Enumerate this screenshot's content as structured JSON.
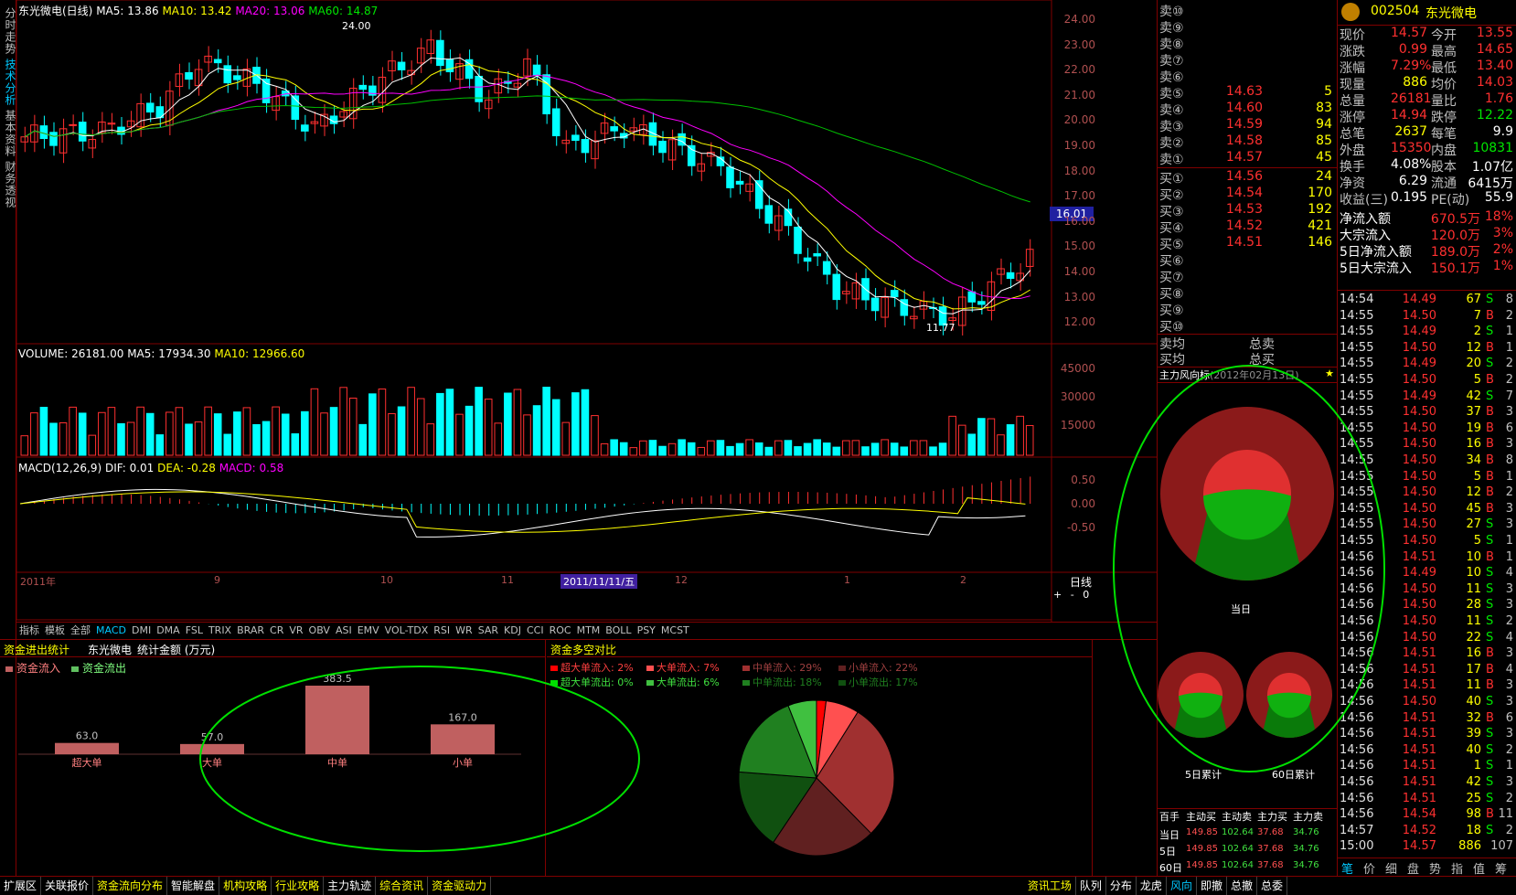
{
  "left_tabs": [
    "分时走势",
    "技术分析",
    "基本资料",
    "财务透视"
  ],
  "header": {
    "title": "东光微电(日线)",
    "ma5": "MA5: 13.86",
    "ma10": "MA10: 13.42",
    "ma20": "MA20: 13.06",
    "ma60": "MA60: 14.87",
    "high_mark": "24.00",
    "low_mark": "11.77",
    "cursor_price": "16.01"
  },
  "price_axis": [
    "24.00",
    "23.00",
    "22.00",
    "21.00",
    "20.00",
    "19.00",
    "18.00",
    "17.00",
    "16.00",
    "15.00",
    "14.00",
    "13.00",
    "12.00"
  ],
  "volume": {
    "label": "VOLUME: 26181.00",
    "ma5": "MA5: 17934.30",
    "ma10": "MA10: 12966.60",
    "axis": [
      "45000",
      "30000",
      "15000"
    ]
  },
  "macd": {
    "label": "MACD(12,26,9)",
    "dif": "DIF: 0.01",
    "dea": "DEA: -0.28",
    "macd": "MACD: 0.58",
    "axis": [
      "0.50",
      "0.00",
      "-0.50"
    ]
  },
  "date_axis": {
    "year": "2011年",
    "m9": "9",
    "m10": "10",
    "m11": "11",
    "cursor_date": "2011/11/11/五",
    "m12": "12",
    "m1": "1",
    "m2": "2",
    "period": "日线"
  },
  "indicator_tabs": [
    "指标",
    "模板",
    "全部",
    "MACD",
    "DMI",
    "DMA",
    "FSL",
    "TRIX",
    "BRAR",
    "CR",
    "VR",
    "OBV",
    "ASI",
    "EMV",
    "VOL-TDX",
    "RSI",
    "WR",
    "SAR",
    "KDJ",
    "CCI",
    "ROC",
    "MTM",
    "BOLL",
    "PSY",
    "MCST"
  ],
  "zoom": [
    "+",
    "-",
    "0"
  ],
  "fund_stats": {
    "title": "资金进出统计",
    "stock": "东光微电",
    "unit": "统计金额 (万元)",
    "legend_in": "资金流入",
    "legend_out": "资金流出",
    "bars": [
      {
        "label": "超大单",
        "value": "63.0",
        "v": 63
      },
      {
        "label": "大单",
        "value": "57.0",
        "v": 57
      },
      {
        "label": "中单",
        "value": "383.5",
        "v": 383.5
      },
      {
        "label": "小单",
        "value": "167.0",
        "v": 167
      }
    ]
  },
  "fund_compare": {
    "title": "资金多空对比",
    "legend": [
      {
        "label": "超大单流入:",
        "pct": "2%",
        "color": "#ff0000"
      },
      {
        "label": "大单流入:",
        "pct": "7%",
        "color": "#ff5050"
      },
      {
        "label": "中单流入:",
        "pct": "29%",
        "color": "#a03030"
      },
      {
        "label": "小单流入:",
        "pct": "22%",
        "color": "#602020"
      },
      {
        "label": "超大单流出:",
        "pct": "0%",
        "color": "#00e000"
      },
      {
        "label": "大单流出:",
        "pct": "6%",
        "color": "#40c040"
      },
      {
        "label": "中单流出:",
        "pct": "18%",
        "color": "#208020"
      },
      {
        "label": "小单流出:",
        "pct": "17%",
        "color": "#105010"
      }
    ],
    "pie": [
      2,
      7,
      29,
      22,
      17,
      18,
      6,
      0
    ]
  },
  "orderbook": {
    "sells": [
      {
        "n": "卖⑩",
        "p": "",
        "v": ""
      },
      {
        "n": "卖⑨",
        "p": "",
        "v": ""
      },
      {
        "n": "卖⑧",
        "p": "",
        "v": ""
      },
      {
        "n": "卖⑦",
        "p": "",
        "v": ""
      },
      {
        "n": "卖⑥",
        "p": "",
        "v": ""
      },
      {
        "n": "卖⑤",
        "p": "14.63",
        "v": "5"
      },
      {
        "n": "卖④",
        "p": "14.60",
        "v": "83"
      },
      {
        "n": "卖③",
        "p": "14.59",
        "v": "94"
      },
      {
        "n": "卖②",
        "p": "14.58",
        "v": "85"
      },
      {
        "n": "卖①",
        "p": "14.57",
        "v": "45"
      }
    ],
    "buys": [
      {
        "n": "买①",
        "p": "14.56",
        "v": "24"
      },
      {
        "n": "买②",
        "p": "14.54",
        "v": "170"
      },
      {
        "n": "买③",
        "p": "14.53",
        "v": "192"
      },
      {
        "n": "买④",
        "p": "14.52",
        "v": "421"
      },
      {
        "n": "买⑤",
        "p": "14.51",
        "v": "146"
      },
      {
        "n": "买⑥",
        "p": "",
        "v": ""
      },
      {
        "n": "买⑦",
        "p": "",
        "v": ""
      },
      {
        "n": "买⑧",
        "p": "",
        "v": ""
      },
      {
        "n": "买⑨",
        "p": "",
        "v": ""
      },
      {
        "n": "买⑩",
        "p": "",
        "v": ""
      }
    ],
    "avg_sell": "卖均",
    "avg_buy": "买均",
    "total_sell": "总卖",
    "total_buy": "总买"
  },
  "wind": {
    "title": "主力风向标",
    "date": "(2012年02月13日)",
    "today": "当日",
    "d5": "5日累计",
    "d60": "60日累计",
    "table_head": [
      "百手",
      "主动买",
      "主动卖",
      "主力买",
      "主力卖"
    ],
    "rows": [
      [
        "当日",
        "149.85",
        "102.64",
        "37.68",
        "34.76"
      ],
      [
        "5日",
        "149.85",
        "102.64",
        "37.68",
        "34.76"
      ],
      [
        "60日",
        "149.85",
        "102.64",
        "37.68",
        "34.76"
      ]
    ]
  },
  "quote": {
    "code": "002504",
    "name": "东光微电",
    "rows": [
      [
        "现价",
        "14.57",
        "今开",
        "13.55"
      ],
      [
        "涨跌",
        "0.99",
        "最高",
        "14.65"
      ],
      [
        "涨幅",
        "7.29%",
        "最低",
        "13.40"
      ],
      [
        "现量",
        "886",
        "均价",
        "14.03"
      ],
      [
        "总量",
        "26181",
        "量比",
        "1.76"
      ],
      [
        "涨停",
        "14.94",
        "跌停",
        "12.22"
      ],
      [
        "总笔",
        "2637",
        "每笔",
        "9.9"
      ],
      [
        "外盘",
        "15350",
        "内盘",
        "10831"
      ],
      [
        "换手",
        "4.08%",
        "股本",
        "1.07亿"
      ],
      [
        "净资",
        "6.29",
        "流通",
        "6415万"
      ],
      [
        "收益(三)",
        "0.195",
        "PE(动)",
        "55.9"
      ]
    ],
    "flows": [
      [
        "净流入额",
        "670.5万",
        "18%"
      ],
      [
        "大宗流入",
        "120.0万",
        "3%"
      ],
      [
        "5日净流入额",
        "189.0万",
        "2%"
      ],
      [
        "5日大宗流入",
        "150.1万",
        "1%"
      ]
    ]
  },
  "ticks": [
    [
      "14:54",
      "14.49",
      "67",
      "S",
      "8"
    ],
    [
      "14:55",
      "14.50",
      "7",
      "B",
      "2"
    ],
    [
      "14:55",
      "14.49",
      "2",
      "S",
      "1"
    ],
    [
      "14:55",
      "14.50",
      "12",
      "B",
      "1"
    ],
    [
      "14:55",
      "14.49",
      "20",
      "S",
      "2"
    ],
    [
      "14:55",
      "14.50",
      "5",
      "B",
      "2"
    ],
    [
      "14:55",
      "14.49",
      "42",
      "S",
      "7"
    ],
    [
      "14:55",
      "14.50",
      "37",
      "B",
      "3"
    ],
    [
      "14:55",
      "14.50",
      "19",
      "B",
      "6"
    ],
    [
      "14:55",
      "14.50",
      "16",
      "B",
      "3"
    ],
    [
      "14:55",
      "14.50",
      "34",
      "B",
      "8"
    ],
    [
      "14:55",
      "14.50",
      "5",
      "B",
      "1"
    ],
    [
      "14:55",
      "14.50",
      "12",
      "B",
      "2"
    ],
    [
      "14:55",
      "14.50",
      "45",
      "B",
      "3"
    ],
    [
      "14:55",
      "14.50",
      "27",
      "S",
      "3"
    ],
    [
      "14:55",
      "14.50",
      "5",
      "S",
      "1"
    ],
    [
      "14:56",
      "14.51",
      "10",
      "B",
      "1"
    ],
    [
      "14:56",
      "14.49",
      "10",
      "S",
      "4"
    ],
    [
      "14:56",
      "14.50",
      "11",
      "S",
      "3"
    ],
    [
      "14:56",
      "14.50",
      "28",
      "S",
      "3"
    ],
    [
      "14:56",
      "14.50",
      "11",
      "S",
      "2"
    ],
    [
      "14:56",
      "14.50",
      "22",
      "S",
      "4"
    ],
    [
      "14:56",
      "14.51",
      "16",
      "B",
      "3"
    ],
    [
      "14:56",
      "14.51",
      "17",
      "B",
      "4"
    ],
    [
      "14:56",
      "14.51",
      "11",
      "B",
      "3"
    ],
    [
      "14:56",
      "14.50",
      "40",
      "S",
      "3"
    ],
    [
      "14:56",
      "14.51",
      "32",
      "B",
      "6"
    ],
    [
      "14:56",
      "14.51",
      "39",
      "S",
      "3"
    ],
    [
      "14:56",
      "14.51",
      "40",
      "S",
      "2"
    ],
    [
      "14:56",
      "14.51",
      "1",
      "S",
      "1"
    ],
    [
      "14:56",
      "14.51",
      "42",
      "S",
      "3"
    ],
    [
      "14:56",
      "14.51",
      "25",
      "S",
      "2"
    ],
    [
      "14:56",
      "14.54",
      "98",
      "B",
      "11"
    ],
    [
      "14:57",
      "14.52",
      "18",
      "S",
      "2"
    ],
    [
      "15:00",
      "14.57",
      "886",
      "",
      "107"
    ]
  ],
  "quote_tabs": [
    "笔",
    "价",
    "细",
    "盘",
    "势",
    "指",
    "值",
    "筹"
  ],
  "statusbar": [
    "扩展区",
    "关联报价",
    "资金流向分布",
    "智能解盘",
    "机构攻略",
    "行业攻略",
    "主力轨迹",
    "综合资讯",
    "资金驱动力"
  ],
  "statusbar_right": [
    "资讯工场",
    "队列",
    "分布",
    "龙虎",
    "风向",
    "即撤",
    "总撤",
    "总委"
  ],
  "colors": {
    "up": "#ff3030",
    "down": "#00ffff",
    "ma5": "#ffffff",
    "ma10": "#ffff00",
    "ma20": "#ff00ff",
    "ma60": "#00c000",
    "frame": "#800000"
  }
}
